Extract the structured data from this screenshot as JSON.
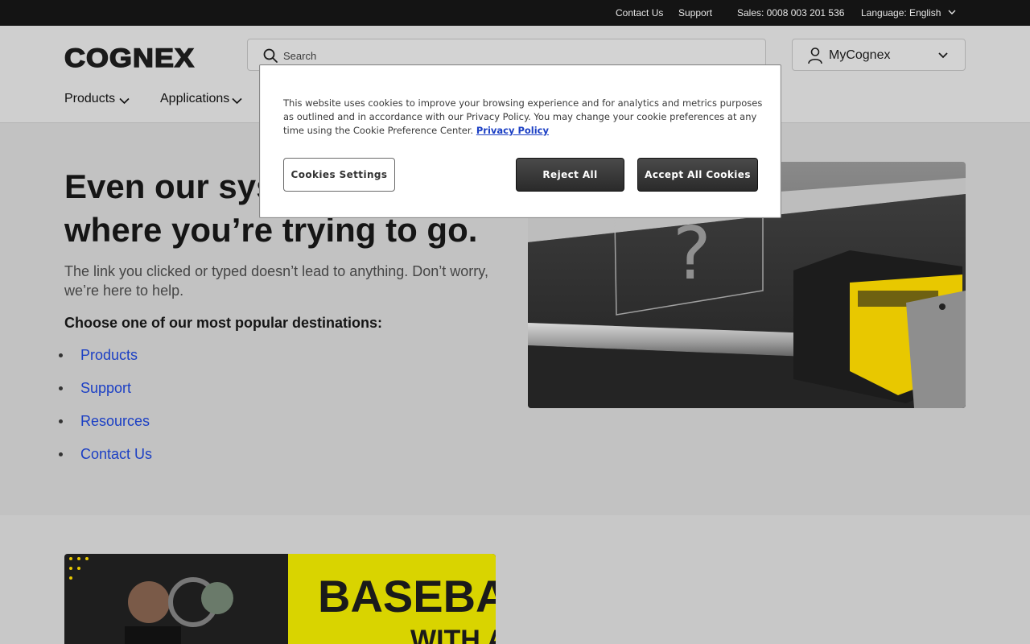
{
  "topbar": {
    "contact": "Contact Us",
    "support": "Support",
    "sales": "Sales: 0008 003 201 536",
    "language": "Language: English"
  },
  "header": {
    "logo": "COGNEX",
    "search_placeholder": "Search",
    "account_label": "MyCognex",
    "nav": [
      "Products",
      "Applications"
    ]
  },
  "main": {
    "heading": "Even our systems can't tell where you’re trying to go.",
    "lead": "The link you clicked or typed doesn’t lead to anything. Don’t worry, we’re here to help.",
    "choose": "Choose one of our most popular destinations:",
    "links": [
      "Products",
      "Support",
      "Resources",
      "Contact Us"
    ]
  },
  "promo": {
    "line1": "BASEBALL",
    "line2": "WITH AI"
  },
  "cookie": {
    "text": "This website uses cookies to improve your browsing experience and for analytics and metrics purposes as outlined and in accordance with our Privacy Policy. You may change your cookie preferences at any time using the Cookie Preference Center.",
    "policy_link": "Privacy Policy",
    "settings_button": "Cookies Settings",
    "reject_button": "Reject All",
    "accept_button": "Accept All Cookies"
  },
  "colors": {
    "link": "#1b3fc4",
    "topbar": "#141414",
    "camera_yellow": "#e8c800"
  }
}
